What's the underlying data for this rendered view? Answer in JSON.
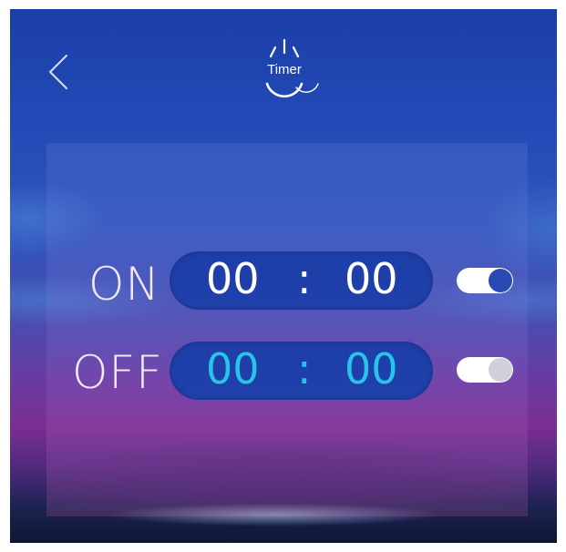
{
  "header": {
    "back_icon": "chevron-left-icon",
    "timer_icon": "power-timer-icon",
    "title": "Timer"
  },
  "timers": [
    {
      "label": "ON",
      "hours": "00",
      "separator": ":",
      "minutes": "00",
      "enabled": true,
      "digit_color": "#ffffff"
    },
    {
      "label": "OFF",
      "hours": "00",
      "separator": ":",
      "minutes": "00",
      "enabled": false,
      "digit_color": "#27c3e8"
    }
  ],
  "colors": {
    "toggle_knob_on": "#2a49b4",
    "toggle_track": "#ffffff",
    "toggle_knob_off": "#cfd0da"
  }
}
